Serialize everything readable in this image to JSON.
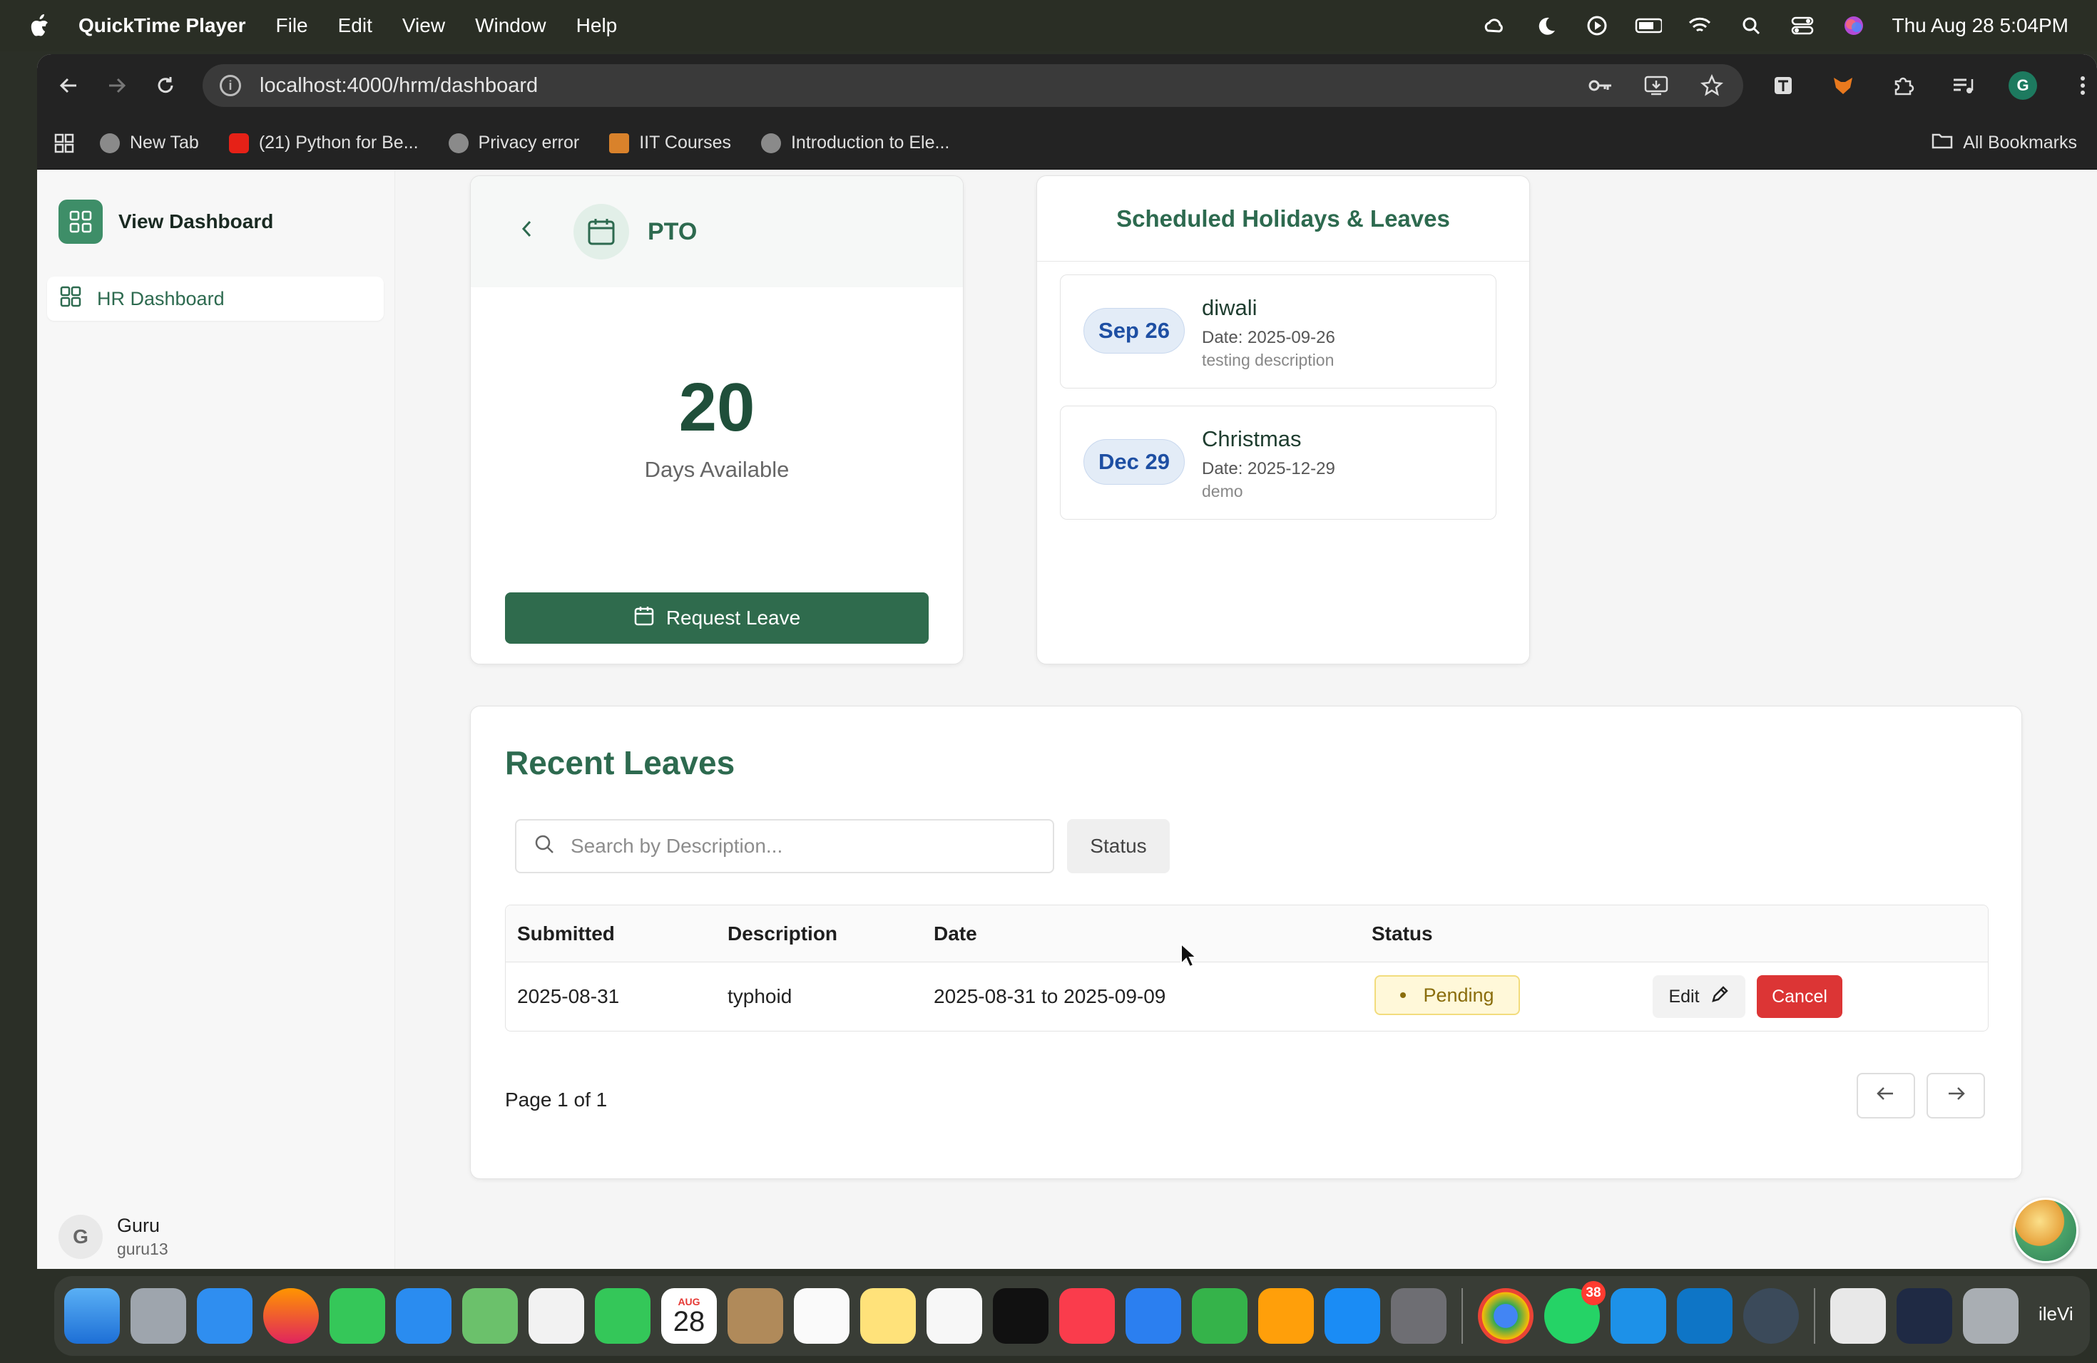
{
  "menubar": {
    "app_name": "QuickTime Player",
    "items": [
      "File",
      "Edit",
      "View",
      "Window",
      "Help"
    ],
    "clock": "Thu Aug 28  5:04PM"
  },
  "browser": {
    "url": "localhost:4000/hrm/dashboard",
    "profile_initial": "G",
    "bookmarks": [
      "New Tab",
      "(21) Python for Be...",
      "Privacy error",
      "IIT Courses",
      "Introduction to Ele..."
    ],
    "all_bookmarks": "All Bookmarks"
  },
  "sidebar": {
    "title": "View Dashboard",
    "items": [
      {
        "label": "HR Dashboard",
        "icon": "grid-icon"
      }
    ],
    "user": {
      "initial": "G",
      "name": "Guru",
      "handle": "guru13"
    }
  },
  "pto": {
    "title": "PTO",
    "days": "20",
    "days_label": "Days Available",
    "request_label": "Request Leave"
  },
  "holidays": {
    "title": "Scheduled Holidays & Leaves",
    "items": [
      {
        "pill": "Sep 26",
        "name": "diwali",
        "date": "Date: 2025-09-26",
        "desc": "testing description"
      },
      {
        "pill": "Dec 29",
        "name": "Christmas",
        "date": "Date: 2025-12-29",
        "desc": "demo"
      }
    ]
  },
  "recent": {
    "title": "Recent Leaves",
    "search_placeholder": "Search by Description...",
    "status_filter": "Status",
    "columns": [
      "Submitted",
      "Description",
      "Date",
      "Status"
    ],
    "rows": [
      {
        "submitted": "2025-08-31",
        "description": "typhoid",
        "date": "2025-08-31 to 2025-09-09",
        "status": "Pending",
        "edit": "Edit",
        "cancel": "Cancel"
      }
    ],
    "page_text": "Page 1 of 1"
  },
  "dock": {
    "calendar_month": "AUG",
    "calendar_day": "28",
    "whatsapp_badge": "38",
    "trailing_label": "ileVi"
  },
  "colors": {
    "brand_green": "#2d6a4f",
    "button_green": "#2f6b4d",
    "cancel_red": "#dc3535",
    "pending_bg": "#fff8d9",
    "date_pill_blue": "#1e4fa3"
  }
}
